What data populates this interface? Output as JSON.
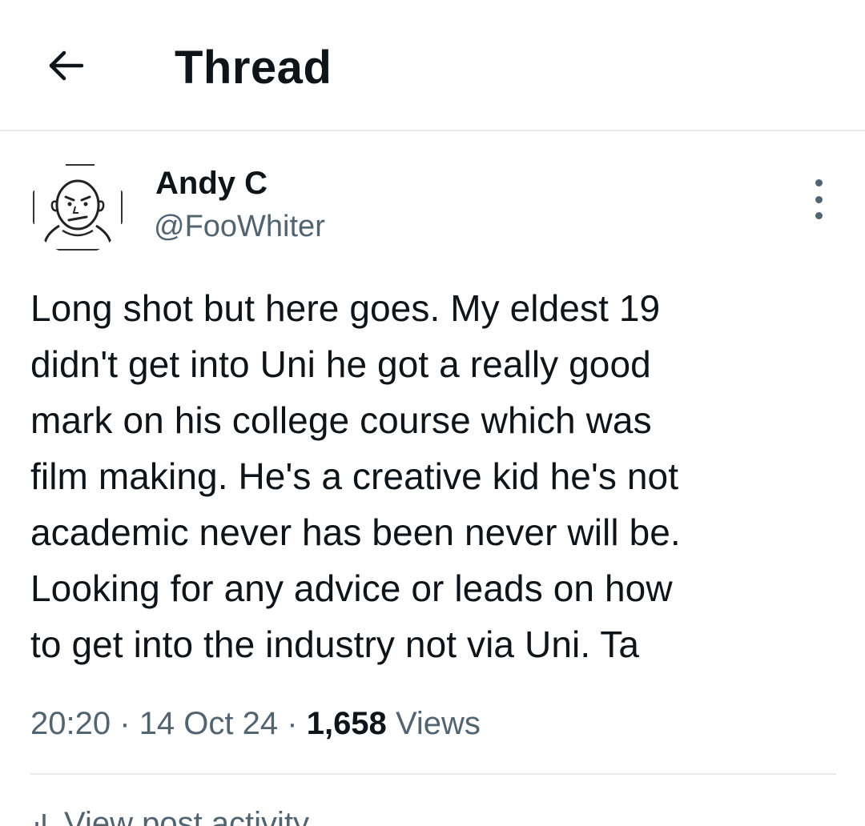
{
  "header": {
    "title": "Thread",
    "back_icon": "arrow-left-icon"
  },
  "post": {
    "author_name": "Andy C",
    "author_handle": "@FooWhiter",
    "avatar_icon": "cartoon-face-avatar",
    "more_icon": "more-vertical-icon",
    "text": "Long shot but here goes. My eldest 19\ndidn't get into Uni he got a really good\nmark on his college course which was\nfilm making. He's a creative kid he's not\nacademic never has been never will be.\nLooking for any advice or leads on how\nto get into the industry not via Uni. Ta",
    "time": "20:20",
    "separator": "·",
    "date": "14 Oct 24",
    "views_count": "1,658",
    "views_label": "Views"
  },
  "activity": {
    "label": "View post activity",
    "icon": "bar-chart-icon"
  },
  "colors": {
    "text_primary": "#0f1419",
    "text_secondary": "#536471",
    "divider": "#e7e9eb",
    "background": "#ffffff"
  }
}
